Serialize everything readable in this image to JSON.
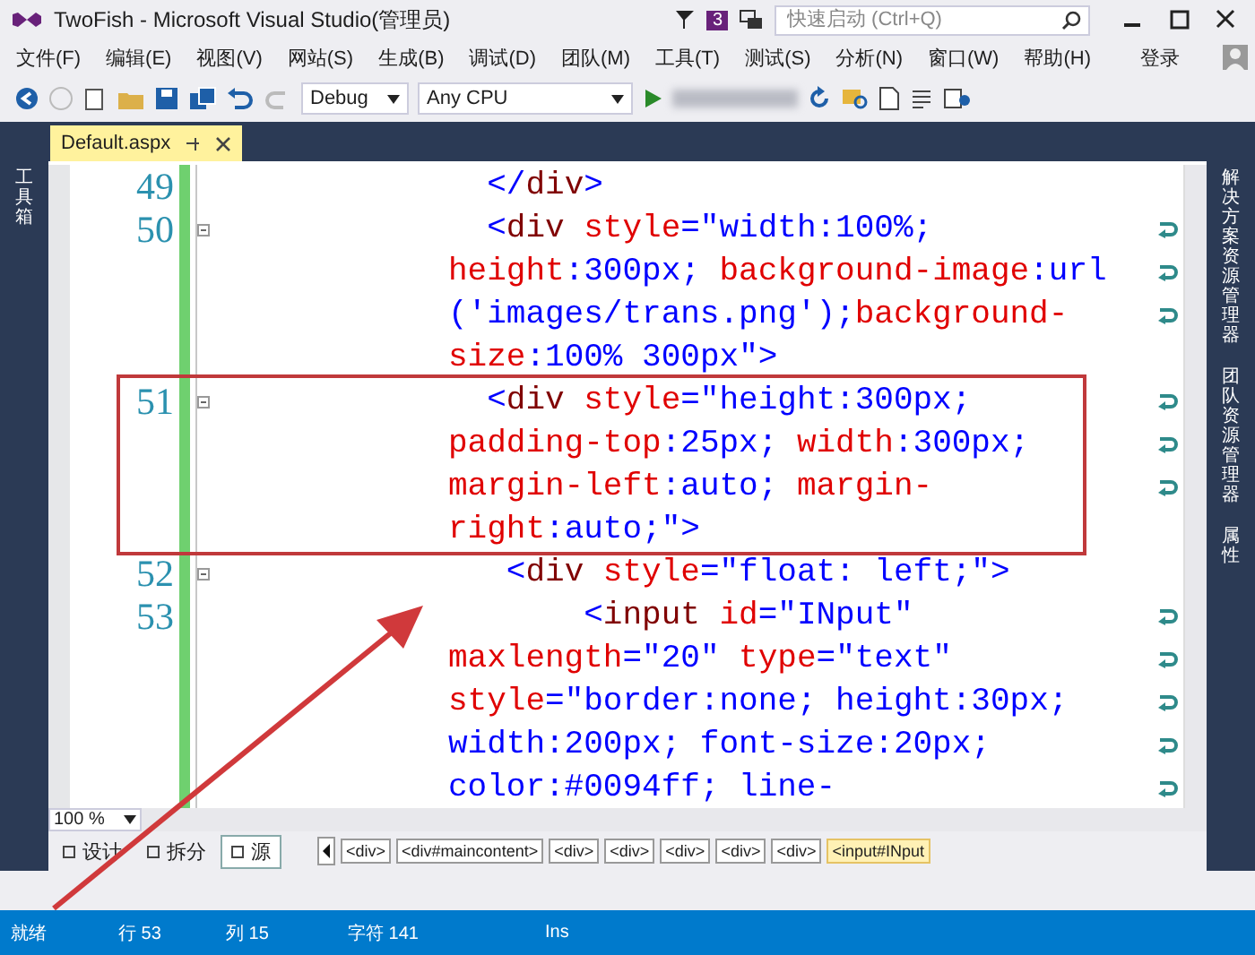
{
  "window": {
    "title": "TwoFish - Microsoft Visual Studio(管理员)",
    "notification_count": "3"
  },
  "quick_launch": {
    "placeholder": "快速启动 (Ctrl+Q)"
  },
  "menu": [
    "文件(F)",
    "编辑(E)",
    "视图(V)",
    "网站(S)",
    "生成(B)",
    "调试(D)",
    "团队(M)",
    "工具(T)",
    "测试(S)",
    "分析(N)",
    "窗口(W)",
    "帮助(H)"
  ],
  "account": "登录",
  "toolbar": {
    "configuration": "Debug",
    "platform": "Any CPU"
  },
  "left_panel_tabs": [
    "工具箱"
  ],
  "right_panel_tabs": [
    "解决方案资源管理器",
    "团队资源管理器",
    "属性"
  ],
  "document_tabs": [
    {
      "label": "Default.aspx",
      "selected": true
    }
  ],
  "editor": {
    "zoom": "100 %",
    "rows": [
      {
        "number": "49",
        "fold": false,
        "wrapped": false,
        "tokens": [
          {
            "kind": "delim",
            "text": "  </"
          },
          {
            "kind": "tag",
            "text": "div"
          },
          {
            "kind": "delim",
            "text": ">"
          }
        ]
      },
      {
        "number": "50",
        "fold": true,
        "wrapped": true,
        "tokens": [
          {
            "kind": "delim",
            "text": "  <"
          },
          {
            "kind": "tag",
            "text": "div"
          },
          {
            "kind": "attr",
            "text": " style"
          },
          {
            "kind": "delim",
            "text": "=\""
          },
          {
            "kind": "value",
            "text": "width:100%;"
          }
        ]
      },
      {
        "fold": false,
        "wrapped": true,
        "tokens": [
          {
            "kind": "attr",
            "text": "height"
          },
          {
            "kind": "delim",
            "text": ":"
          },
          {
            "kind": "value",
            "text": "300px; "
          },
          {
            "kind": "attr",
            "text": "background-image"
          },
          {
            "kind": "delim",
            "text": ":"
          },
          {
            "kind": "value",
            "text": "url"
          }
        ]
      },
      {
        "fold": false,
        "wrapped": true,
        "tokens": [
          {
            "kind": "value",
            "text": "('images/trans.png');"
          },
          {
            "kind": "attr",
            "text": "background-"
          }
        ]
      },
      {
        "fold": false,
        "wrapped": false,
        "tokens": [
          {
            "kind": "attr",
            "text": "size"
          },
          {
            "kind": "delim",
            "text": ":"
          },
          {
            "kind": "value",
            "text": "100% 300px"
          },
          {
            "kind": "delim",
            "text": "\">"
          }
        ]
      },
      {
        "number": "51",
        "fold": true,
        "wrapped": true,
        "tokens": [
          {
            "kind": "delim",
            "text": "  <"
          },
          {
            "kind": "tag",
            "text": "div"
          },
          {
            "kind": "attr",
            "text": " style"
          },
          {
            "kind": "delim",
            "text": "=\""
          },
          {
            "kind": "value",
            "text": "height:300px;"
          }
        ]
      },
      {
        "fold": false,
        "wrapped": true,
        "tokens": [
          {
            "kind": "attr",
            "text": "padding-top"
          },
          {
            "kind": "delim",
            "text": ":"
          },
          {
            "kind": "value",
            "text": "25px; "
          },
          {
            "kind": "attr",
            "text": "width"
          },
          {
            "kind": "delim",
            "text": ":"
          },
          {
            "kind": "value",
            "text": "300px;"
          }
        ]
      },
      {
        "fold": false,
        "wrapped": true,
        "tokens": [
          {
            "kind": "attr",
            "text": "margin-left"
          },
          {
            "kind": "delim",
            "text": ":"
          },
          {
            "kind": "value",
            "text": "auto; "
          },
          {
            "kind": "attr",
            "text": "margin-"
          }
        ]
      },
      {
        "fold": false,
        "wrapped": false,
        "tokens": [
          {
            "kind": "attr",
            "text": "right"
          },
          {
            "kind": "delim",
            "text": ":"
          },
          {
            "kind": "value",
            "text": "auto;"
          },
          {
            "kind": "delim",
            "text": "\">"
          }
        ]
      },
      {
        "number": "52",
        "fold": true,
        "wrapped": false,
        "tokens": [
          {
            "kind": "delim",
            "text": "   <"
          },
          {
            "kind": "tag",
            "text": "div"
          },
          {
            "kind": "attr",
            "text": " style"
          },
          {
            "kind": "delim",
            "text": "=\""
          },
          {
            "kind": "value",
            "text": "float: left;"
          },
          {
            "kind": "delim",
            "text": "\">"
          }
        ]
      },
      {
        "number": "53",
        "fold": false,
        "wrapped": true,
        "tokens": [
          {
            "kind": "delim",
            "text": "       <"
          },
          {
            "kind": "tag",
            "text": "input"
          },
          {
            "kind": "attr",
            "text": " id"
          },
          {
            "kind": "delim",
            "text": "=\""
          },
          {
            "kind": "value",
            "text": "INput"
          },
          {
            "kind": "delim",
            "text": "\""
          }
        ]
      },
      {
        "fold": false,
        "wrapped": true,
        "tokens": [
          {
            "kind": "attr",
            "text": "maxlength"
          },
          {
            "kind": "delim",
            "text": "=\""
          },
          {
            "kind": "value",
            "text": "20"
          },
          {
            "kind": "delim",
            "text": "\" "
          },
          {
            "kind": "attr",
            "text": "type"
          },
          {
            "kind": "delim",
            "text": "=\""
          },
          {
            "kind": "value",
            "text": "text"
          },
          {
            "kind": "delim",
            "text": "\""
          }
        ]
      },
      {
        "fold": false,
        "wrapped": true,
        "tokens": [
          {
            "kind": "attr",
            "text": "style"
          },
          {
            "kind": "delim",
            "text": "=\""
          },
          {
            "kind": "value",
            "text": "border:none; height:30px;"
          }
        ]
      },
      {
        "fold": false,
        "wrapped": true,
        "tokens": [
          {
            "kind": "value",
            "text": "width:200px; font-size:20px;"
          }
        ]
      },
      {
        "fold": false,
        "wrapped": true,
        "tokens": [
          {
            "kind": "value",
            "text": "color:#0094ff; line-"
          }
        ]
      }
    ]
  },
  "view_tabs": [
    {
      "label": "设计",
      "selected": false
    },
    {
      "label": "拆分",
      "selected": false
    },
    {
      "label": "源",
      "selected": true
    }
  ],
  "breadcrumb": [
    {
      "label": "<div>",
      "selected": false
    },
    {
      "label": "<div#maincontent>",
      "selected": false
    },
    {
      "label": "<div>",
      "selected": false
    },
    {
      "label": "<div>",
      "selected": false
    },
    {
      "label": "<div>",
      "selected": false
    },
    {
      "label": "<div>",
      "selected": false
    },
    {
      "label": "<div>",
      "selected": false
    },
    {
      "label": "<input#INput",
      "selected": true
    }
  ],
  "status_bar": {
    "state": "就绪",
    "line": "行 53",
    "column": "列 15",
    "chars": "字符 141",
    "mode": "Ins"
  }
}
